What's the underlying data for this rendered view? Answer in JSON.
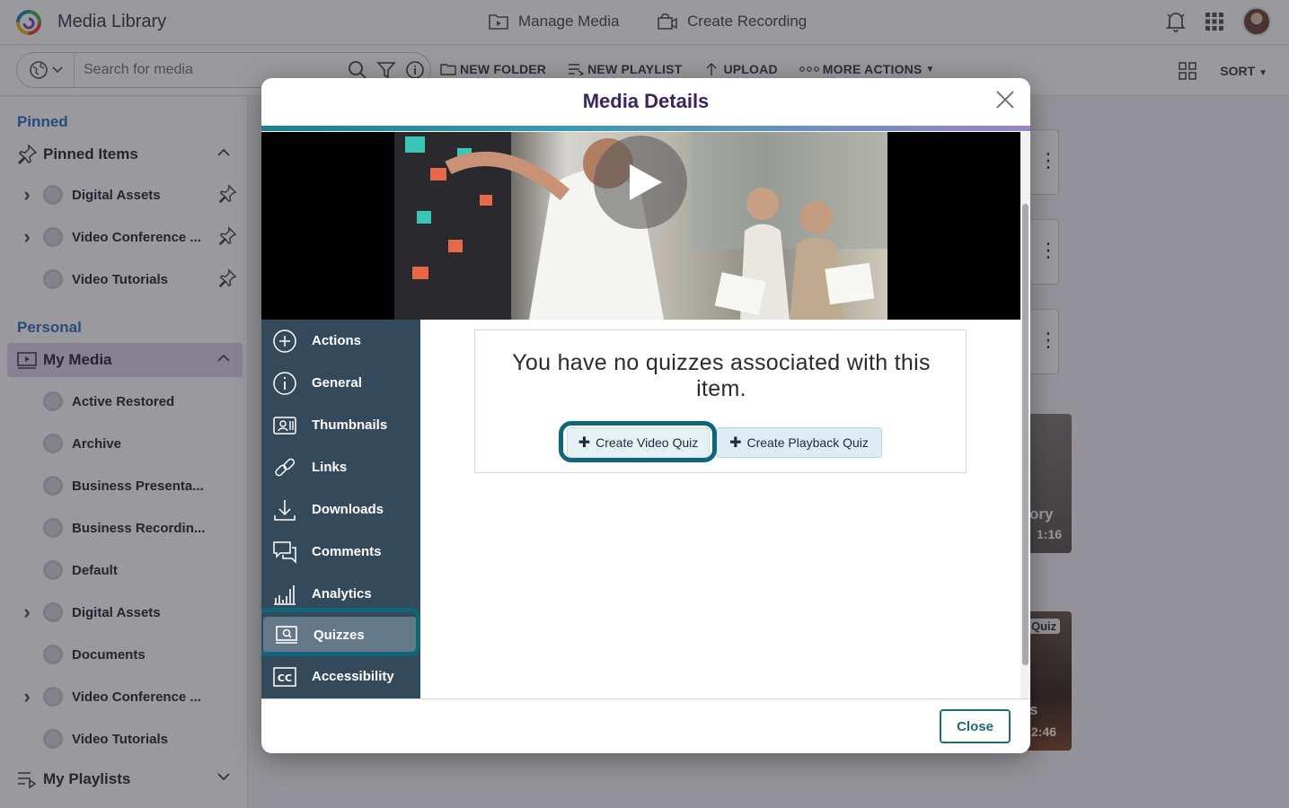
{
  "header": {
    "app_title": "Media Library",
    "nav": [
      {
        "label": "Manage Media",
        "icon": "folder-play-icon"
      },
      {
        "label": "Create Recording",
        "icon": "camera-icon"
      }
    ]
  },
  "toolbar": {
    "search_placeholder": "Search for media",
    "actions": [
      {
        "label": "NEW FOLDER",
        "icon": "new-folder-icon"
      },
      {
        "label": "NEW PLAYLIST",
        "icon": "new-playlist-icon"
      },
      {
        "label": "UPLOAD",
        "icon": "upload-icon"
      },
      {
        "label": "MORE ACTIONS",
        "icon": "more-icon"
      }
    ],
    "sort_label": "SORT"
  },
  "sidebar": {
    "pinned_label": "Pinned",
    "pinned_group": "Pinned Items",
    "pinned_items": [
      {
        "label": "Digital Assets",
        "expandable": true
      },
      {
        "label": "Video Conference ...",
        "expandable": true
      },
      {
        "label": "Video Tutorials",
        "expandable": false
      }
    ],
    "personal_label": "Personal",
    "my_media_group": "My Media",
    "my_media_items": [
      {
        "label": "Active Restored",
        "expandable": false
      },
      {
        "label": "Archive",
        "expandable": false
      },
      {
        "label": "Business Presenta...",
        "expandable": false
      },
      {
        "label": "Business Recordin...",
        "expandable": false
      },
      {
        "label": "Default",
        "expandable": false
      },
      {
        "label": "Digital Assets",
        "expandable": true
      },
      {
        "label": "Documents",
        "expandable": false
      },
      {
        "label": "Video Conference ...",
        "expandable": true
      },
      {
        "label": "Video Tutorials",
        "expandable": false
      }
    ],
    "playlists_group": "My Playlists"
  },
  "background": {
    "card1_text": "ory",
    "card1_duration": "1:16",
    "card2_badge": "Quiz",
    "card2_text": "s",
    "card2_duration": "2:46"
  },
  "modal": {
    "title": "Media Details",
    "nav": [
      {
        "label": "Actions",
        "icon": "plus-circle-icon"
      },
      {
        "label": "General",
        "icon": "info-circle-icon"
      },
      {
        "label": "Thumbnails",
        "icon": "thumbnails-icon"
      },
      {
        "label": "Links",
        "icon": "link-icon"
      },
      {
        "label": "Downloads",
        "icon": "download-icon"
      },
      {
        "label": "Comments",
        "icon": "comments-icon"
      },
      {
        "label": "Analytics",
        "icon": "analytics-icon"
      },
      {
        "label": "Quizzes",
        "icon": "quiz-icon"
      },
      {
        "label": "Accessibility",
        "icon": "cc-icon"
      }
    ],
    "active_nav": "Quizzes",
    "quiz_message": "You have no quizzes associated with this item.",
    "create_video_quiz": "Create Video Quiz",
    "create_playback_quiz": "Create Playback Quiz",
    "close_label": "Close"
  }
}
